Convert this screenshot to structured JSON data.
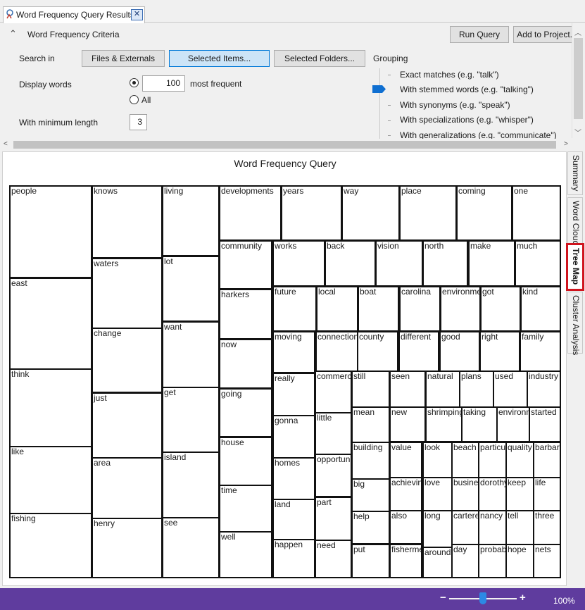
{
  "tab": {
    "title": "Word Frequency Query Results",
    "close_glyph": "✕"
  },
  "criteria": {
    "header": "Word Frequency Criteria",
    "collapse_glyph": "⌃",
    "run_query": "Run Query",
    "add_to_project": "Add to Project...",
    "search_in_label": "Search in",
    "search_in_options": [
      "Files & Externals",
      "Selected Items...",
      "Selected Folders..."
    ],
    "search_in_selected": "Selected Items...",
    "display_words_label": "Display words",
    "display_count": "100",
    "most_frequent": "most frequent",
    "all_label": "All",
    "display_mode": "most frequent",
    "min_length_label": "With minimum length",
    "min_length": "3",
    "grouping_label": "Grouping",
    "grouping_options": [
      "Exact matches (e.g. \"talk\")",
      "With stemmed words (e.g. \"talking\")",
      "With synonyms (e.g. \"speak\")",
      "With specializations (e.g. \"whisper\")",
      "With generalizations (e.g. \"communicate\")"
    ],
    "grouping_selected": "With stemmed words (e.g. \"talking\")"
  },
  "chart_data": {
    "type": "treemap",
    "title": "Word Frequency Query",
    "words": [
      "people",
      "knows",
      "living",
      "developments",
      "years",
      "way",
      "place",
      "coming",
      "one",
      "waters",
      "lot",
      "community",
      "works",
      "back",
      "vision",
      "north",
      "make",
      "much",
      "east",
      "harkers",
      "future",
      "local",
      "boat",
      "carolina",
      "environme",
      "got",
      "kind",
      "change",
      "want",
      "now",
      "moving",
      "connection",
      "county",
      "different",
      "good",
      "right",
      "family",
      "think",
      "just",
      "get",
      "going",
      "really",
      "commerce",
      "still",
      "seen",
      "natural",
      "plans",
      "used",
      "industry",
      "mean",
      "new",
      "shrimping",
      "taking",
      "environm",
      "started",
      "gonna",
      "little",
      "like",
      "area",
      "island",
      "house",
      "building",
      "value",
      "look",
      "beach",
      "particu",
      "quality",
      "barbar",
      "homes",
      "opportuni",
      "big",
      "achievin",
      "love",
      "busine",
      "dorothy",
      "keep",
      "life",
      "time",
      "land",
      "part",
      "help",
      "also",
      "long",
      "cartere",
      "nancy",
      "tell",
      "three",
      "fishing",
      "henry",
      "see",
      "well",
      "happen",
      "need",
      "put",
      "fisherme",
      "around",
      "day",
      "probab",
      "hope",
      "nets"
    ]
  },
  "side_tabs": [
    "Summary",
    "Word Cloud",
    "Tree Map",
    "Cluster Analysis"
  ],
  "active_side_tab": "Tree Map",
  "status": {
    "zoom": "100%",
    "minus": "−",
    "plus": "+"
  }
}
